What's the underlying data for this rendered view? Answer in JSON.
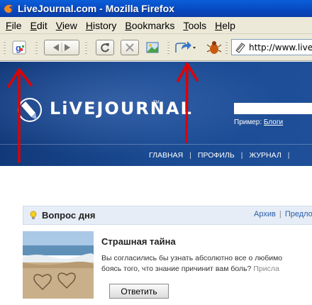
{
  "window": {
    "title": "LiveJournal.com - Mozilla Firefox"
  },
  "menu": {
    "items": [
      "File",
      "Edit",
      "View",
      "History",
      "Bookmarks",
      "Tools",
      "Help"
    ],
    "underline": [
      "F",
      "E",
      "V",
      "H",
      "B",
      "T",
      "H"
    ]
  },
  "toolbar": {
    "url": "http://www.live"
  },
  "banner": {
    "logo": "LiVEJOURNAL",
    "tm": "TM",
    "example_label": "Пример:",
    "example_link": "Блоги",
    "nav": [
      "ГЛАВНАЯ",
      "ПРОФИЛЬ",
      "ЖУРНАЛ"
    ]
  },
  "qotd": {
    "header": "Вопрос дня",
    "archive": "Архив",
    "suggest": "Предло",
    "question_title": "Страшная тайна",
    "question_line1": "Вы согласились бы узнать абсолютно все о любимо",
    "question_line2": "боясь того, что знание причинит вам боль?",
    "question_more": "Присла",
    "answer_button": "Ответить"
  },
  "colors": {
    "titlebar": "#0848c0",
    "chrome": "#ece9d8",
    "banner": "#1a4a92",
    "qotd_header": "#e6edf6",
    "link": "#2a5caa",
    "annotation": "#e00000"
  }
}
